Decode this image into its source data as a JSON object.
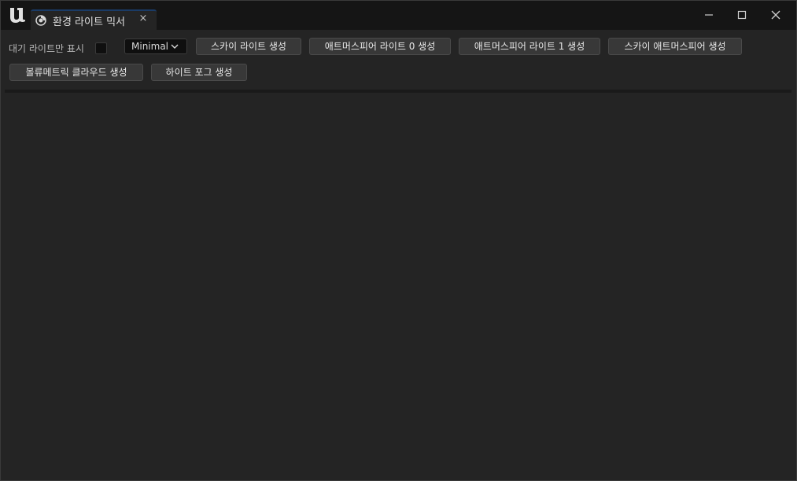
{
  "window": {
    "tab_title": "환경 라이트 믹서",
    "tab_close": "×"
  },
  "toolbar": {
    "show_standby_label": "대기 라이트만 표시",
    "mode_value": "Minimal",
    "buttons": [
      "스카이 라이트 생성",
      "애트머스피어 라이트 0 생성",
      "애트머스피어 라이트 1 생성",
      "스카이 애트머스피어 생성",
      "볼류메트릭 클라우드 생성",
      "하이트 포그 생성"
    ]
  },
  "icons": {
    "app": "unreal-engine-logo",
    "tab": "environment-light-mixer-icon",
    "minimize": "minimize-icon",
    "maximize": "maximize-icon",
    "close": "close-icon"
  }
}
